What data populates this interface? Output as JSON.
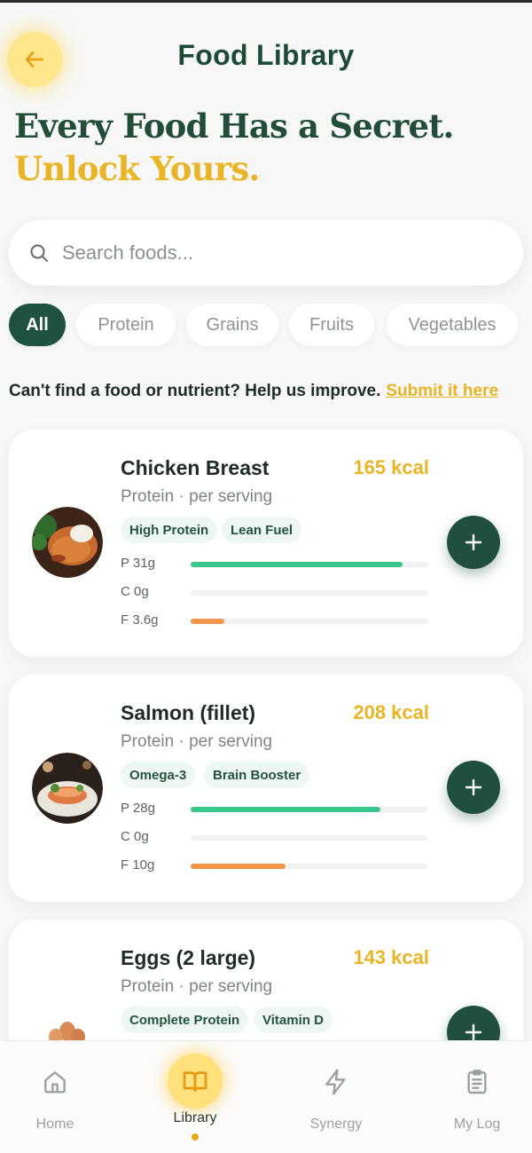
{
  "header": {
    "title": "Food Library",
    "back_label": "back"
  },
  "hero": {
    "line1": "Every Food Has a Secret.",
    "line2": "Unlock Yours."
  },
  "search": {
    "placeholder": "Search foods..."
  },
  "chips": [
    "All",
    "Protein",
    "Grains",
    "Fruits",
    "Vegetables"
  ],
  "active_chip": "All",
  "feedback": {
    "text": "Can't find a food or nutrient? Help us improve.",
    "link": "Submit it here"
  },
  "foods": [
    {
      "name": "Chicken Breast",
      "kcal": "165 kcal",
      "subtitle": "Protein · per serving",
      "tags": [
        "High Protein",
        "Lean Fuel"
      ],
      "protein_label": "P 31g",
      "carb_label": "C 0g",
      "fat_label": "F 3.6g",
      "protein_fill": 0.89,
      "carb_fill": 0,
      "fat_fill": 0.14
    },
    {
      "name": "Salmon (fillet)",
      "kcal": "208 kcal",
      "subtitle": "Protein · per serving",
      "tags": [
        "Omega-3",
        "Brain Booster"
      ],
      "protein_label": "P 28g",
      "carb_label": "C 0g",
      "fat_label": "F 10g",
      "protein_fill": 0.8,
      "carb_fill": 0,
      "fat_fill": 0.4
    },
    {
      "name": "Eggs (2 large)",
      "kcal": "143 kcal",
      "subtitle": "Protein · per serving",
      "tags": [
        "Complete Protein",
        "Vitamin D"
      ]
    }
  ],
  "nav": [
    {
      "label": "Home",
      "icon": "home-icon"
    },
    {
      "label": "Library",
      "icon": "book-icon",
      "active": true
    },
    {
      "label": "Synergy",
      "icon": "lightning-icon"
    },
    {
      "label": "My Log",
      "icon": "clipboard-icon"
    }
  ],
  "colors": {
    "brand_green": "#1f4f3d",
    "accent_yellow": "#e9b425",
    "protein_bar": "#3ac78e",
    "fat_bar": "#f0964a"
  }
}
